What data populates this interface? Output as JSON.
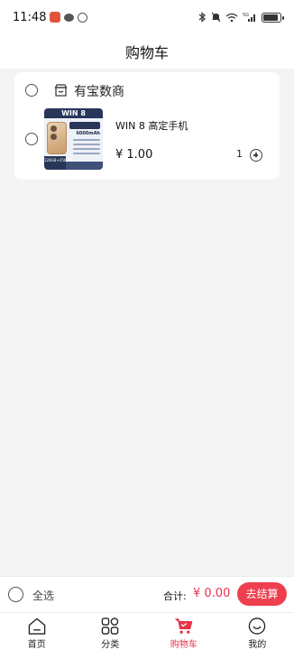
{
  "status_bar": {
    "time": "11:48",
    "network": "5G"
  },
  "header": {
    "title": "购物车"
  },
  "cart": {
    "shop": {
      "name": "有宝数商",
      "selected": false
    },
    "items": [
      {
        "title": "WIN 8 高定手机",
        "price": "¥ 1.00",
        "quantity": "1",
        "selected": false,
        "thumbnail": {
          "title": "WIN 8",
          "capacity": "6000mAh",
          "storage": "128GB+256GB"
        }
      }
    ]
  },
  "checkout": {
    "select_all_label": "全选",
    "total_label": "合计:",
    "total_amount": "¥ 0.00",
    "checkout_label": "去结算"
  },
  "tabbar": {
    "active_color": "#e8334a",
    "items": [
      {
        "label": "首页",
        "icon": "home-icon"
      },
      {
        "label": "分类",
        "icon": "category-icon"
      },
      {
        "label": "购物车",
        "icon": "cart-icon",
        "active": true
      },
      {
        "label": "我的",
        "icon": "profile-icon"
      }
    ]
  }
}
